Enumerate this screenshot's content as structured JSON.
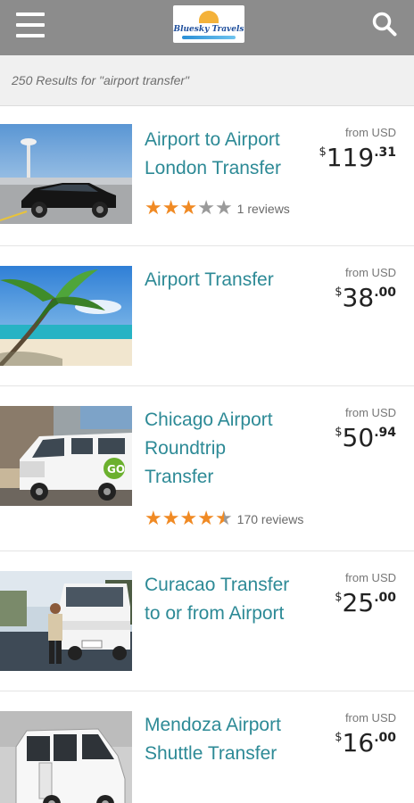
{
  "header": {
    "logo_text": "Bluesky Travels",
    "menu_icon": "hamburger-menu-icon",
    "search_icon": "search-icon",
    "bar_color": "#8c8c8c"
  },
  "results": {
    "summary": "250 Results for \"airport transfer\""
  },
  "listings": [
    {
      "title_line1": "Airport to Airport",
      "title_line2": "London Transfer",
      "title_line3": "",
      "from": "from USD",
      "currency": "$",
      "price_whole": "119",
      "price_cents": ".31",
      "rating": 3,
      "max_rating": 5,
      "reviews": "1 reviews",
      "image": "black-sedan-at-airport"
    },
    {
      "title_line1": "Airport Transfer",
      "title_line2": "",
      "title_line3": "",
      "from": "from USD",
      "currency": "$",
      "price_whole": "38",
      "price_cents": ".00",
      "rating": null,
      "reviews": "",
      "image": "palm-tree-beach"
    },
    {
      "title_line1": "Chicago Airport",
      "title_line2": "Roundtrip",
      "title_line3": "Transfer",
      "from": "from USD",
      "currency": "$",
      "price_whole": "50",
      "price_cents": ".94",
      "rating": 4.5,
      "max_rating": 5,
      "reviews": "170 reviews",
      "image": "white-go-van"
    },
    {
      "title_line1": "Curacao Transfer",
      "title_line2": "to or from Airport",
      "title_line3": "",
      "from": "from USD",
      "currency": "$",
      "price_whole": "25",
      "price_cents": ".00",
      "rating": null,
      "reviews": "",
      "image": "white-minibus-with-driver"
    },
    {
      "title_line1": "Mendoza Airport",
      "title_line2": "Shuttle Transfer",
      "title_line3": "",
      "from": "from USD",
      "currency": "$",
      "price_whole": "16",
      "price_cents": ".00",
      "rating": null,
      "reviews": "",
      "image": "white-sprinter-van"
    }
  ],
  "colors": {
    "title": "#2d8a96",
    "star_on": "#f08a24",
    "star_off": "#9a9a9a"
  }
}
